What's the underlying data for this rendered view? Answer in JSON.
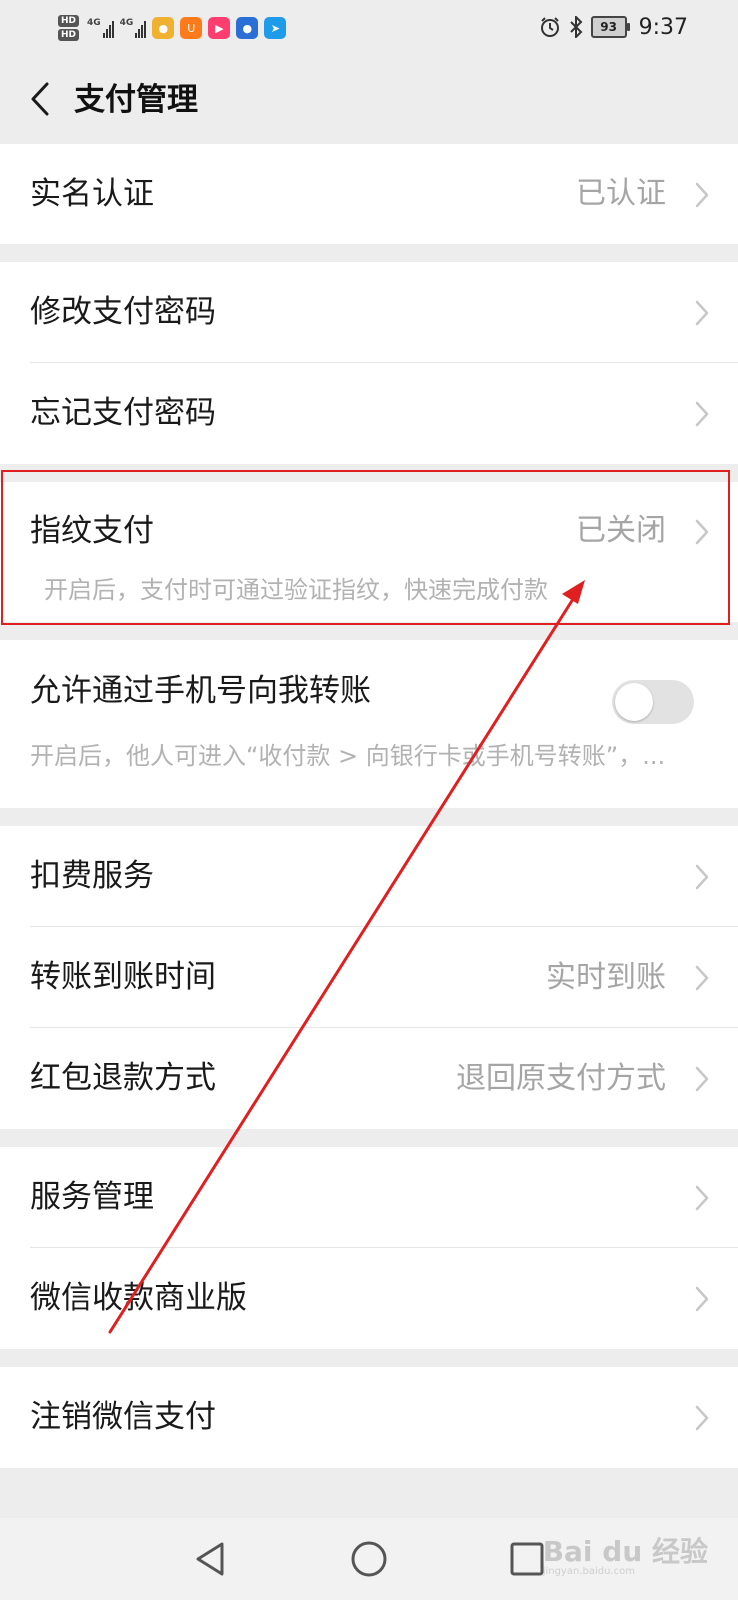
{
  "status_bar": {
    "hd1": "HD",
    "hd2": "HD",
    "net1": "4G",
    "net2": "4G",
    "battery": "93",
    "time": "9:37",
    "icons": [
      "alarm-icon",
      "bluetooth-icon"
    ]
  },
  "header": {
    "title": "支付管理"
  },
  "sections": {
    "realname": {
      "label": "实名认证",
      "value": "已认证"
    },
    "password": {
      "change_label": "修改支付密码",
      "forgot_label": "忘记支付密码"
    },
    "fingerprint": {
      "label": "指纹支付",
      "value": "已关闭",
      "desc": "开启后，支付时可通过验证指纹，快速完成付款"
    },
    "phone_transfer": {
      "label": "允许通过手机号向我转账",
      "desc": "开启后，他人可进入“收付款 > 向银行卡或手机号转账”，...",
      "enabled": false
    },
    "services": {
      "deduction_label": "扣费服务",
      "transfer_time_label": "转账到账时间",
      "transfer_time_value": "实时到账",
      "refund_label": "红包退款方式",
      "refund_value": "退回原支付方式"
    },
    "manage": {
      "service_mgmt_label": "服务管理",
      "business_label": "微信收款商业版"
    },
    "cancel": {
      "label": "注销微信支付"
    }
  },
  "nav_bar": {
    "buttons": [
      "back-triangle-icon",
      "home-circle-icon",
      "recents-square-icon"
    ]
  },
  "watermark": {
    "brand": "Bai du 经验",
    "url": "jingyan.baidu.com"
  },
  "annotation": {
    "color": "#e02020"
  }
}
